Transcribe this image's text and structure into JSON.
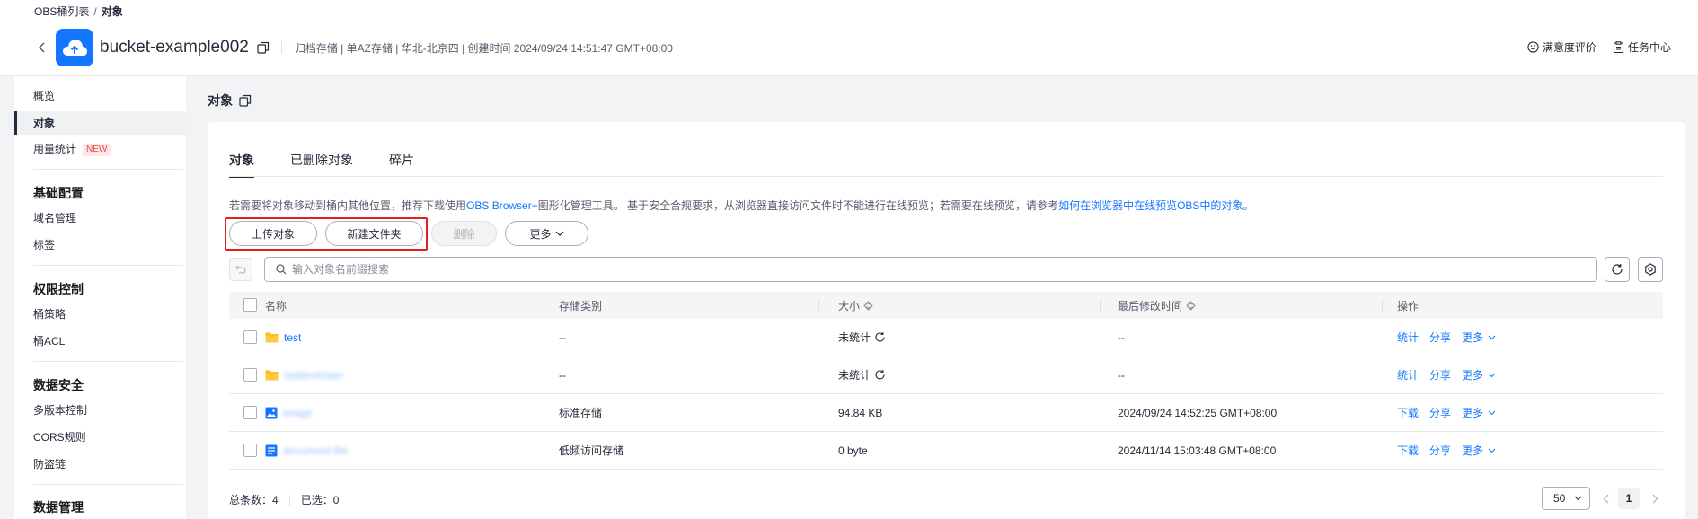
{
  "breadcrumb": {
    "parent": "OBS桶列表",
    "separator": "/",
    "current": "对象"
  },
  "bucket": {
    "name": "bucket-example002",
    "meta": "归档存储 | 单AZ存储 | 华北-北京四 | 创建时间  2024/09/24 14:51:47 GMT+08:00"
  },
  "top_links": {
    "satisfaction": "满意度评价",
    "task_center": "任务中心"
  },
  "sidebar": {
    "overview": "概览",
    "objects": "对象",
    "usage": "用量统计",
    "usage_badge": "NEW",
    "groups": [
      {
        "title": "基础配置",
        "items": [
          "域名管理",
          "标签"
        ]
      },
      {
        "title": "权限控制",
        "items": [
          "桶策略",
          "桶ACL"
        ]
      },
      {
        "title": "数据安全",
        "items": [
          "多版本控制",
          "CORS规则",
          "防盗链"
        ]
      },
      {
        "title": "数据管理",
        "items": []
      }
    ]
  },
  "page_title": "对象",
  "tabs": [
    "对象",
    "已删除对象",
    "碎片"
  ],
  "notice": {
    "prefix": "若需要将对象移动到桶内其他位置，推荐下载使用",
    "link1": "OBS Browser+",
    "middle": "图形化管理工具。 基于安全合规要求，从浏览器直接访问文件时不能进行在线预览；若需要在线预览，请参考",
    "link2": "如何在浏览器中在线预览OBS中的对象",
    "suffix": "。"
  },
  "actions": {
    "upload": "上传对象",
    "new_folder": "新建文件夹",
    "delete": "删除",
    "more": "更多"
  },
  "search": {
    "placeholder": "输入对象名前缀搜索"
  },
  "table": {
    "headers": {
      "name": "名称",
      "storage": "存储类别",
      "size": "大小",
      "modified": "最后修改时间",
      "ops": "操作"
    },
    "rows": [
      {
        "name": "test",
        "type": "folder",
        "storage": "--",
        "size": "未统计",
        "modified": "--",
        "op1": "统计",
        "op2": "分享",
        "op3": "更多"
      },
      {
        "name": "hiddenfolder",
        "type": "folder",
        "storage": "--",
        "size": "未统计",
        "modified": "--",
        "op1": "统计",
        "op2": "分享",
        "op3": "更多"
      },
      {
        "name": "image",
        "type": "image",
        "storage": "标准存储",
        "size": "94.84 KB",
        "modified": "2024/09/24 14:52:25 GMT+08:00",
        "op1": "下载",
        "op2": "分享",
        "op3": "更多"
      },
      {
        "name": "document-file",
        "type": "doc",
        "storage": "低频访问存储",
        "size": "0 byte",
        "modified": "2024/11/14 15:03:48 GMT+08:00",
        "op1": "下载",
        "op2": "分享",
        "op3": "更多"
      }
    ]
  },
  "footer": {
    "total_label": "总条数：",
    "total": "4",
    "selected_label": "已选：",
    "selected": "0",
    "page_size": "50",
    "current_page": "1"
  },
  "colors": {
    "accent": "#1476ff",
    "folder": "#ffb814",
    "highlight": "#e02020"
  }
}
